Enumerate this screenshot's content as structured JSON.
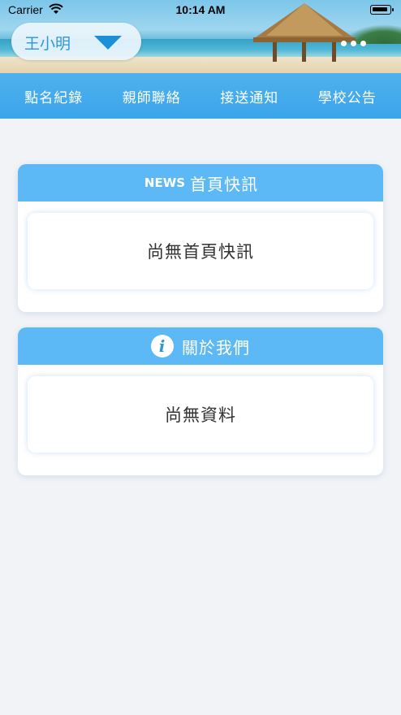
{
  "status_bar": {
    "carrier": "Carrier",
    "time": "10:14 AM"
  },
  "header": {
    "selected_user": "王小明"
  },
  "nav": {
    "items": [
      {
        "label": "點名紀錄"
      },
      {
        "label": "親師聯絡"
      },
      {
        "label": "接送通知"
      },
      {
        "label": "學校公告"
      }
    ]
  },
  "news_card": {
    "icon_text": "NEWS",
    "title": "首頁快訊",
    "empty_text": "尚無首頁快訊"
  },
  "about_card": {
    "icon_text": "i",
    "title": "關於我們",
    "empty_text": "尚無資料"
  },
  "colors": {
    "accent": "#3aa5ea",
    "card_header": "#5cb9f5",
    "background": "#f1f3f7"
  }
}
